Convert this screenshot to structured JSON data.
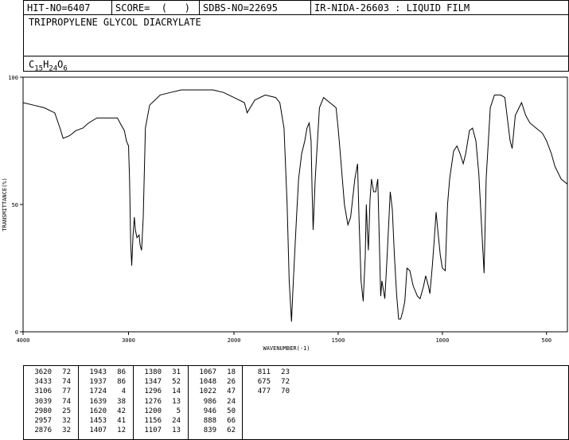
{
  "header": {
    "hit_no": "HIT-NO=6407",
    "score": "SCORE=  (   )",
    "sdbs_no": "SDBS-NO=22695",
    "ir_nida": "IR-NIDA-26603 : LIQUID FILM"
  },
  "compound": {
    "name": "TRIPROPYLENE GLYCOL DIACRYLATE",
    "formula_parts": [
      "C",
      "15",
      "H",
      "24",
      "O",
      "6"
    ]
  },
  "chart_data": {
    "type": "line",
    "xlabel": "WAVENUMBER(-1)",
    "ylabel": "TRANSMITTANCE(%)",
    "xlim": [
      4000,
      400
    ],
    "ylim": [
      0,
      100
    ],
    "x_ticks": [
      4000,
      3000,
      2000,
      1500,
      1000,
      500
    ],
    "x_tick_labels": [
      "4000",
      "3000",
      "2000",
      "1500",
      "1000",
      "500"
    ],
    "y_ticks": [
      0,
      50,
      100
    ],
    "y_tick_labels": [
      "0",
      "50",
      "100"
    ],
    "series": [
      {
        "x": [
          4000,
          3900,
          3800,
          3700,
          3650,
          3620,
          3560,
          3500,
          3433,
          3380,
          3300,
          3200,
          3106,
          3080,
          3039,
          3020,
          3000,
          2990,
          2980,
          2970,
          2957,
          2945,
          2935,
          2920,
          2900,
          2890,
          2876,
          2860,
          2840,
          2800,
          2700,
          2600,
          2500,
          2400,
          2300,
          2200,
          2100,
          2000,
          1950,
          1943,
          1937,
          1900,
          1850,
          1800,
          1780,
          1760,
          1745,
          1735,
          1724,
          1715,
          1700,
          1690,
          1675,
          1660,
          1650,
          1639,
          1630,
          1625,
          1620,
          1610,
          1590,
          1570,
          1540,
          1510,
          1500,
          1490,
          1470,
          1453,
          1440,
          1420,
          1407,
          1400,
          1390,
          1380,
          1370,
          1365,
          1360,
          1355,
          1347,
          1340,
          1330,
          1320,
          1310,
          1296,
          1290,
          1276,
          1265,
          1250,
          1240,
          1230,
          1220,
          1210,
          1200,
          1190,
          1180,
          1170,
          1156,
          1140,
          1120,
          1107,
          1090,
          1080,
          1067,
          1060,
          1048,
          1040,
          1030,
          1022,
          1010,
          1000,
          986,
          975,
          965,
          946,
          930,
          915,
          900,
          888,
          870,
          855,
          839,
          825,
          811,
          800,
          790,
          770,
          750,
          720,
          700,
          690,
          675,
          665,
          650,
          620,
          600,
          580,
          550,
          520,
          500,
          477,
          460,
          430,
          400
        ],
        "y": [
          90,
          89,
          88,
          86,
          80,
          76,
          77,
          79,
          80,
          82,
          84,
          84,
          84,
          82,
          79,
          75,
          73,
          60,
          35,
          26,
          38,
          45,
          40,
          37,
          38,
          34,
          32,
          45,
          80,
          89,
          93,
          94,
          95,
          95,
          95,
          95,
          94,
          92,
          90,
          88,
          86,
          91,
          93,
          92,
          90,
          80,
          50,
          20,
          4,
          20,
          45,
          60,
          70,
          75,
          80,
          82,
          75,
          55,
          40,
          60,
          88,
          92,
          90,
          88,
          80,
          70,
          50,
          42,
          45,
          60,
          66,
          45,
          20,
          12,
          30,
          50,
          40,
          32,
          52,
          60,
          55,
          55,
          60,
          14,
          20,
          13,
          30,
          55,
          48,
          30,
          15,
          5,
          5,
          8,
          12,
          25,
          24,
          18,
          14,
          13,
          18,
          22,
          18,
          15,
          26,
          35,
          47,
          40,
          30,
          25,
          24,
          50,
          60,
          71,
          73,
          70,
          66,
          70,
          79,
          80,
          75,
          62,
          40,
          23,
          60,
          88,
          93,
          93,
          92,
          85,
          75,
          72,
          85,
          90,
          85,
          82,
          80,
          78,
          75,
          70,
          65,
          60,
          58
        ]
      }
    ]
  },
  "peak_table": [
    {
      "wavenumbers": [
        "3620",
        "3433",
        "3106",
        "3039",
        "2980",
        "2957",
        "2876"
      ],
      "transmittance": [
        "72",
        "74",
        "77",
        "74",
        "25",
        "32",
        "32"
      ]
    },
    {
      "wavenumbers": [
        "1943",
        "1937",
        "1724",
        "1639",
        "1620",
        "1453",
        "1407"
      ],
      "transmittance": [
        "86",
        "86",
        "4",
        "38",
        "42",
        "41",
        "12"
      ]
    },
    {
      "wavenumbers": [
        "1380",
        "1347",
        "1296",
        "1276",
        "1200",
        "1156",
        "1107"
      ],
      "transmittance": [
        "31",
        "52",
        "14",
        "13",
        "5",
        "24",
        "13"
      ]
    },
    {
      "wavenumbers": [
        "1067",
        "1048",
        "1022",
        "986",
        "946",
        "888",
        "839"
      ],
      "transmittance": [
        "18",
        "26",
        "47",
        "24",
        "50",
        "66",
        "62"
      ]
    },
    {
      "wavenumbers": [
        "811",
        "675",
        "477"
      ],
      "transmittance": [
        "23",
        "72",
        "70"
      ]
    }
  ]
}
